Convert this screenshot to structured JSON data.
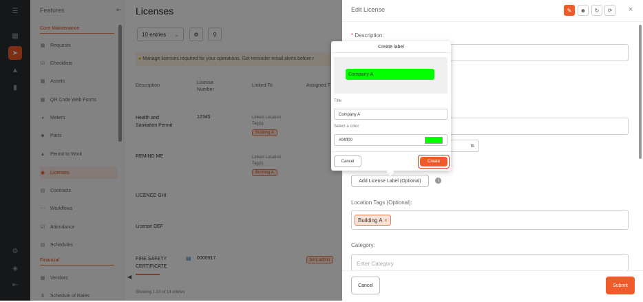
{
  "sidebar": {
    "header": "Features",
    "sections": [
      {
        "label": "Core Maintenance"
      },
      {
        "label": "Financial"
      }
    ],
    "items": [
      {
        "label": "Requests",
        "icon": "requests-icon"
      },
      {
        "label": "Checklists",
        "icon": "checklist-icon"
      },
      {
        "label": "Assets",
        "icon": "assets-icon"
      },
      {
        "label": "QR Code Web Forms",
        "icon": "qr-icon"
      },
      {
        "label": "Meters",
        "icon": "meter-icon"
      },
      {
        "label": "Parts",
        "icon": "parts-icon"
      },
      {
        "label": "Permit to Work",
        "icon": "permit-icon"
      },
      {
        "label": "Licenses",
        "icon": "license-icon",
        "active": true
      },
      {
        "label": "Contracts",
        "icon": "contracts-icon"
      },
      {
        "label": "Workflows",
        "icon": "workflow-icon"
      },
      {
        "label": "Attendance",
        "icon": "attendance-icon"
      },
      {
        "label": "Schedules",
        "icon": "calendar-icon"
      },
      {
        "label": "Vendors",
        "icon": "vendors-icon"
      },
      {
        "label": "Schedule of Rates",
        "icon": "dollar-icon"
      }
    ]
  },
  "main": {
    "title": "Licenses",
    "entries_select": "10 entries",
    "notice": "Manage licenses required for your operations. Get reminder email alerts before r",
    "columns": [
      "Description",
      "License Number",
      "Linked To",
      "Assigned T"
    ],
    "rows": [
      {
        "description": "Health and Sanitation Permit",
        "number": "12345",
        "linked": "Linked Location Tag(s)",
        "tag": "Building A"
      },
      {
        "description": "REMIND ME",
        "number": "",
        "linked": "Linked Location Tag(s)",
        "tag": "Building A"
      },
      {
        "description": "LICENCE GHI",
        "number": "",
        "linked": "",
        "tag": ""
      },
      {
        "description": "License DEF",
        "number": "",
        "linked": "",
        "tag": ""
      },
      {
        "description": "FIRE SAFETY CERTIFICATE",
        "number": "0000917",
        "linked": "",
        "tag": "",
        "assignee": "benj admin"
      }
    ],
    "footer": "Showing 1-10 of 14 entries"
  },
  "panel": {
    "title": "Edit License",
    "description_label": "Description:",
    "description_required": "*",
    "behind_button": "ts",
    "add_label_button": "Add License Label (Optional)",
    "location_tags_label": "Location Tags (Optional):",
    "location_tag": "Building A",
    "location_tag_remove": "×",
    "category_label": "Category:",
    "category_placeholder": "Enter Category",
    "cancel": "Cancel",
    "submit": "Submit",
    "close": "×"
  },
  "popup": {
    "title": "Create label",
    "preview_text": "Company A",
    "title_label": "Title",
    "title_value": "Company A",
    "color_label": "Select a color",
    "color_value": "#04ff00",
    "cancel": "Cancel",
    "create": "Create"
  },
  "colors": {
    "accent": "#ef5b2a",
    "label_color": "#04ff00"
  }
}
